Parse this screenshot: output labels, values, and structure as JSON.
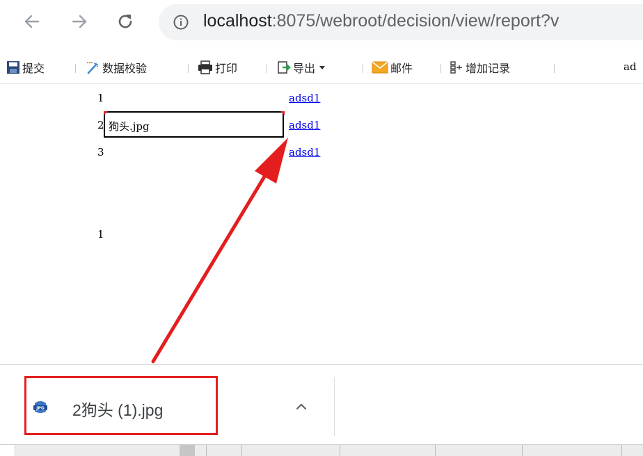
{
  "browser": {
    "url_host": "localhost",
    "url_rest": ":8075/webroot/decision/view/report?v"
  },
  "toolbar": {
    "submit_label": "提交",
    "validate_label": "数据校验",
    "print_label": "打印",
    "export_label": "导出",
    "email_label": "邮件",
    "add_record_label": "增加记录",
    "truncated_text": "ad"
  },
  "report": {
    "rows": [
      {
        "num": "1",
        "link": "adsd1"
      },
      {
        "num": "2",
        "cell_text": "狗头.jpg",
        "link": "adsd1"
      },
      {
        "num": "3",
        "link": "adsd1"
      }
    ],
    "lower_num": "1"
  },
  "download": {
    "filename": "2狗头 (1).jpg",
    "icon_label": "JPG"
  },
  "colors": {
    "highlight_red": "#e41e1e",
    "link_blue": "#0000ee",
    "address_bar_bg": "#f1f3f4"
  },
  "icons": {
    "back": "arrow-left-icon",
    "forward": "arrow-right-icon",
    "reload": "reload-icon",
    "info": "info-icon",
    "file": "jpg-file-icon",
    "chevron": "chevron-up-icon"
  }
}
